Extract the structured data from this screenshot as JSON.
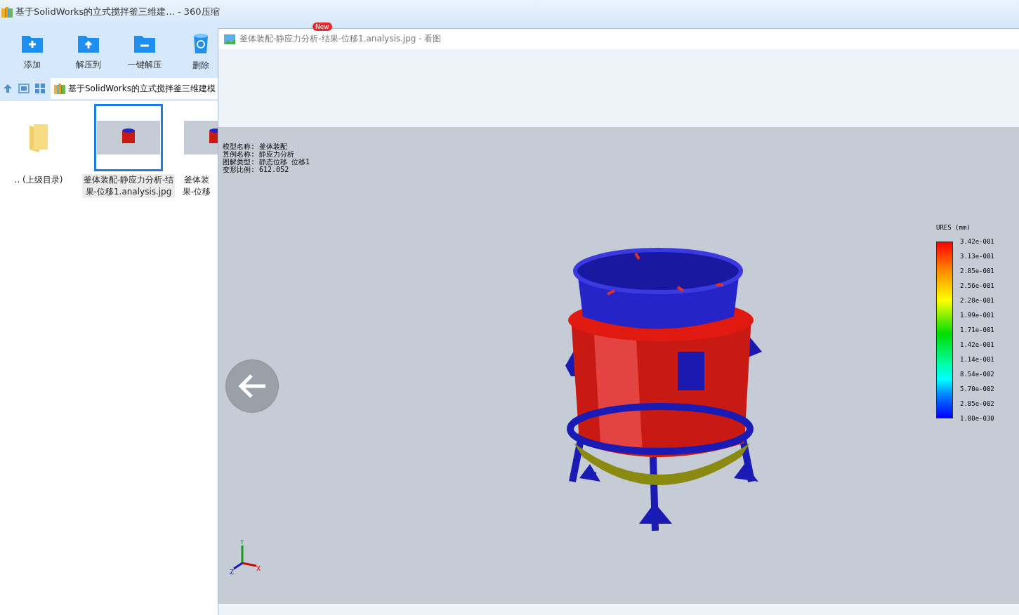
{
  "archive_window": {
    "title": "基于SolidWorks的立式搅拌釜三维建...  - 360压缩",
    "toolbar": [
      {
        "label": "添加",
        "kind": "add"
      },
      {
        "label": "解压到",
        "kind": "extract"
      },
      {
        "label": "一键解压",
        "kind": "oneclick"
      },
      {
        "label": "删除",
        "kind": "delete"
      }
    ],
    "new_badge": "New",
    "address": "基于SolidWorks的立式搅拌釜三维建模",
    "files": [
      {
        "lines": [
          ".. (上级目录)"
        ],
        "kind": "folder",
        "selected": false
      },
      {
        "lines": [
          "釜体装配-静应力分析-结",
          "果-位移1.analysis.jpg"
        ],
        "kind": "image",
        "selected": true
      },
      {
        "lines": [
          "釜体装",
          "果-位移"
        ],
        "kind": "image",
        "selected": false
      }
    ]
  },
  "viewer": {
    "title": "釜体装配-静应力分析-结果-位移1.analysis.jpg - 看图",
    "info_lines": [
      "模型名称: 釜体装配",
      "算例名称: 静应力分析",
      "图解类型: 静态位移 位移1",
      "变形比例: 612.052"
    ],
    "legend_title": "URES (mm)",
    "legend_labels": [
      "3.42e-001",
      "3.13e-001",
      "2.85e-001",
      "2.56e-001",
      "2.28e-001",
      "1.99e-001",
      "1.71e-001",
      "1.42e-001",
      "1.14e-001",
      "8.54e-002",
      "5.70e-002",
      "2.85e-002",
      "1.00e-030"
    ],
    "axes": {
      "y": "Y",
      "x": "X",
      "z": "Z"
    }
  }
}
